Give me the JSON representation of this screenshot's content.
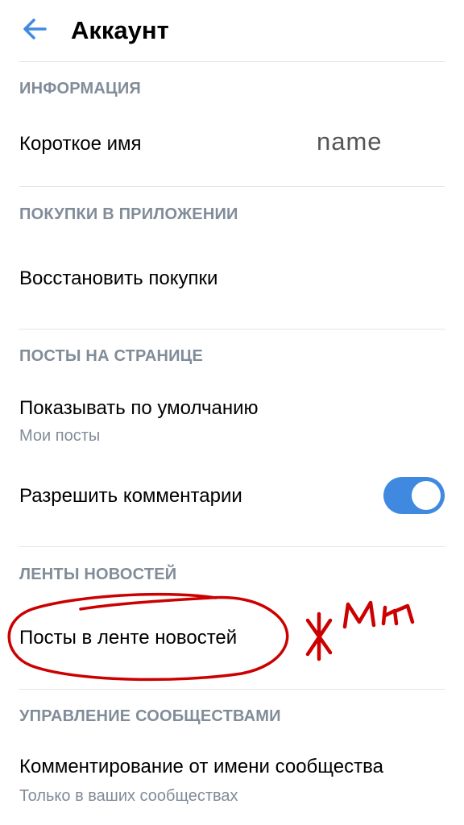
{
  "header": {
    "title": "Аккаунт",
    "back_icon": "arrow-left-icon",
    "accent": "#3f8ae0"
  },
  "sections": {
    "info": {
      "title": "ИНФОРМАЦИЯ",
      "short_name_label": "Короткое имя",
      "short_name_value": "name"
    },
    "purchases": {
      "title": "ПОКУПКИ В ПРИЛОЖЕНИИ",
      "restore_label": "Восстановить покупки"
    },
    "posts": {
      "title": "ПОСТЫ НА СТРАНИЦЕ",
      "default_label": "Показывать по умолчанию",
      "default_value": "Мои посты",
      "comments_label": "Разрешить комментарии",
      "comments_enabled": true
    },
    "feeds": {
      "title": "ЛЕНТЫ НОВОСТЕЙ",
      "feed_posts_label": "Посты в ленте новостей"
    },
    "communities": {
      "title": "УПРАВЛЕНИЕ СООБЩЕСТВАМИ",
      "comment_as_label": "Комментирование от имени сообщества",
      "comment_as_value": "Только в ваших сообществах"
    }
  },
  "annotation": {
    "text": "жми",
    "color": "#cc0000"
  }
}
